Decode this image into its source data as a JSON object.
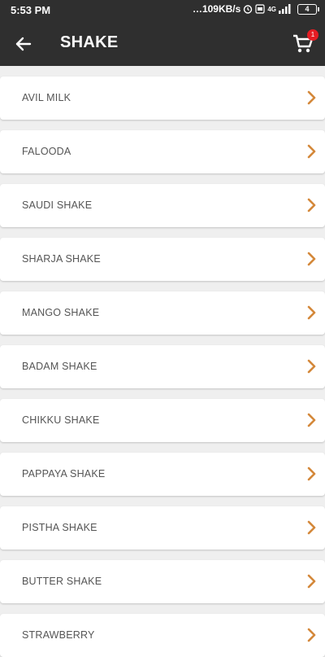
{
  "status_bar": {
    "time": "5:53 PM",
    "net_speed": "…109KB/s",
    "network": "4G",
    "battery": "4"
  },
  "header": {
    "title": "SHAKE",
    "cart_count": "1",
    "back_icon": "arrow-left-icon",
    "cart_icon": "shopping-cart-icon"
  },
  "colors": {
    "appbar": "#2f2f2f",
    "accent": "#d4883a",
    "badge": "#e51c23"
  },
  "items": [
    {
      "label": "AVIL MILK"
    },
    {
      "label": "FALOODA"
    },
    {
      "label": "SAUDI SHAKE"
    },
    {
      "label": "SHARJA SHAKE"
    },
    {
      "label": "MANGO SHAKE"
    },
    {
      "label": "BADAM SHAKE"
    },
    {
      "label": "CHIKKU SHAKE"
    },
    {
      "label": "PAPPAYA SHAKE"
    },
    {
      "label": "PISTHA SHAKE"
    },
    {
      "label": "BUTTER SHAKE"
    },
    {
      "label": "STRAWBERRY"
    }
  ]
}
